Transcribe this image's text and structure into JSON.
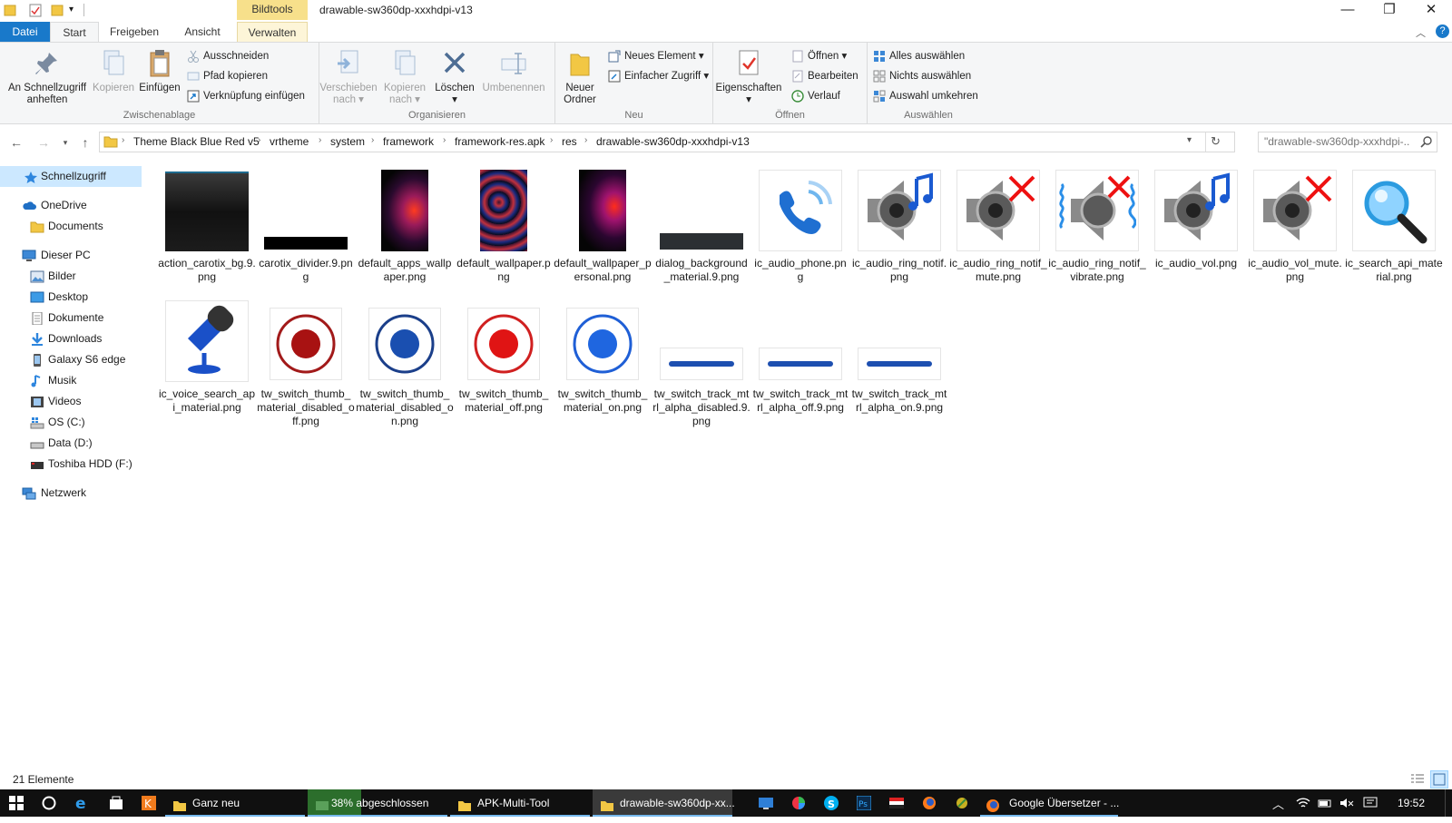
{
  "window": {
    "title": "drawable-sw360dp-xxxhdpi-v13",
    "context_tab": "Bildtools",
    "minimize": "—",
    "maximize": "❐",
    "close": "✕"
  },
  "tabs": [
    "Datei",
    "Start",
    "Freigeben",
    "Ansicht",
    "Verwalten"
  ],
  "ribbon": {
    "clipboard": {
      "pin": "An Schnellzugriff anheften",
      "copy": "Kopieren",
      "paste": "Einfügen",
      "cut": "Ausschneiden",
      "copy_path": "Pfad kopieren",
      "paste_shortcut": "Verknüpfung einfügen",
      "label": "Zwischenablage"
    },
    "organize": {
      "move": "Verschieben nach",
      "copy_to": "Kopieren nach",
      "delete": "Löschen",
      "rename": "Umbenennen",
      "label": "Organisieren"
    },
    "new": {
      "new_folder": "Neuer Ordner",
      "new_item": "Neues Element",
      "easy_access": "Einfacher Zugriff",
      "label": "Neu"
    },
    "open": {
      "properties": "Eigenschaften",
      "open": "Öffnen",
      "edit": "Bearbeiten",
      "history": "Verlauf",
      "label": "Öffnen"
    },
    "select": {
      "select_all": "Alles auswählen",
      "select_none": "Nichts auswählen",
      "invert": "Auswahl umkehren",
      "label": "Auswählen"
    }
  },
  "breadcrumb": [
    "Theme Black Blue Red v5",
    "vrtheme",
    "system",
    "framework",
    "framework-res.apk",
    "res",
    "drawable-sw360dp-xxxhdpi-v13"
  ],
  "search_placeholder": "\"drawable-sw360dp-xxxhdpi-...",
  "nav": {
    "quick_access": "Schnellzugriff",
    "onedrive": "OneDrive",
    "documents": "Documents",
    "this_pc": "Dieser PC",
    "pc_items": [
      "Bilder",
      "Desktop",
      "Dokumente",
      "Downloads",
      "Galaxy S6 edge",
      "Musik",
      "Videos",
      "OS (C:)",
      "Data (D:)",
      "Toshiba HDD (F:)"
    ],
    "network": "Netzwerk"
  },
  "files": [
    "action_carotix_bg.9.png",
    "carotix_divider.9.png",
    "default_apps_wallpaper.png",
    "default_wallpaper.png",
    "default_wallpaper_personal.png",
    "dialog_background_material.9.png",
    "ic_audio_phone.png",
    "ic_audio_ring_notif.png",
    "ic_audio_ring_notif_mute.png",
    "ic_audio_ring_notif_vibrate.png",
    "ic_audio_vol.png",
    "ic_audio_vol_mute.png",
    "ic_search_api_material.png",
    "ic_voice_search_api_material.png",
    "tw_switch_thumb_material_disabled_off.png",
    "tw_switch_thumb_material_disabled_on.png",
    "tw_switch_thumb_material_off.png",
    "tw_switch_thumb_material_on.png",
    "tw_switch_track_mtrl_alpha_disabled.9.png",
    "tw_switch_track_mtrl_alpha_off.9.png",
    "tw_switch_track_mtrl_alpha_on.9.png"
  ],
  "status": {
    "count": "21 Elemente"
  },
  "taskbar": {
    "items": [
      "Ganz neu",
      "38% abgeschlossen",
      "APK-Multi-Tool",
      "drawable-sw360dp-xx...",
      "Google Übersetzer - ..."
    ],
    "progress": 0.38,
    "clock": "19:52"
  },
  "colors": {
    "accent": "#1979ca",
    "context_tab": "#f7e08b",
    "selection": "#cce8ff"
  }
}
